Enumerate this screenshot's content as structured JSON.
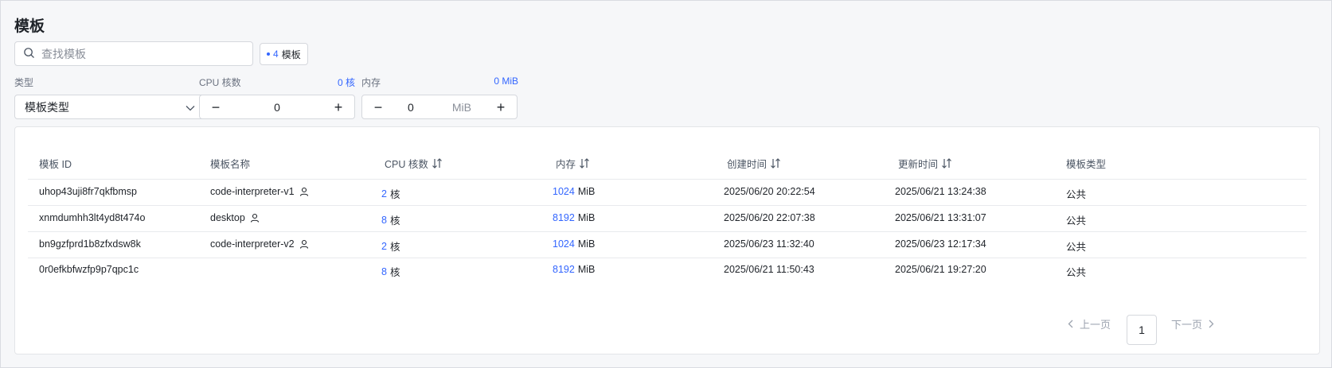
{
  "page_title": "模板",
  "search": {
    "placeholder": "查找模板"
  },
  "badge": {
    "count": "4",
    "label": "模板"
  },
  "filters": {
    "type_label": "类型",
    "type_value": "模板类型",
    "cpu_label": "CPU 核数",
    "cpu_value_display": "0 核",
    "cpu_stepper_value": "0",
    "memory_label": "内存",
    "memory_value_display": "0 MiB",
    "memory_stepper_value": "0",
    "memory_unit": "MiB"
  },
  "table": {
    "headers": {
      "id": "模板 ID",
      "name": "模板名称",
      "cpu": "CPU 核数",
      "memory": "内存",
      "created": "创建时间",
      "updated": "更新时间",
      "type": "模板类型"
    },
    "rows": [
      {
        "id": "uhop43uji8fr7qkfbmsp",
        "name": "code-interpreter-v1",
        "cpu": "2",
        "cpu_unit": "核",
        "memory": "1024",
        "memory_unit": "MiB",
        "created": "2025/06/20 20:22:54",
        "updated": "2025/06/21 13:24:38",
        "type": "公共"
      },
      {
        "id": "xnmdumhh3lt4yd8t474o",
        "name": "desktop",
        "cpu": "8",
        "cpu_unit": "核",
        "memory": "8192",
        "memory_unit": "MiB",
        "created": "2025/06/20 22:07:38",
        "updated": "2025/06/21 13:31:07",
        "type": "公共"
      },
      {
        "id": "bn9gzfprd1b8zfxdsw8k",
        "name": "code-interpreter-v2",
        "cpu": "2",
        "cpu_unit": "核",
        "memory": "1024",
        "memory_unit": "MiB",
        "created": "2025/06/23 11:32:40",
        "updated": "2025/06/23 12:17:34",
        "type": "公共"
      },
      {
        "id": "0r0efkbfwzfp9p7qpc1c",
        "name": "",
        "cpu": "8",
        "cpu_unit": "核",
        "memory": "8192",
        "memory_unit": "MiB",
        "created": "2025/06/21 11:50:43",
        "updated": "2025/06/21 19:27:20",
        "type": "公共"
      }
    ]
  },
  "pagination": {
    "prev": "上一页",
    "current": "1",
    "next": "下一页"
  },
  "colors": {
    "accent": "#3366ff",
    "border": "#d5d8dd",
    "text": "#1f2329",
    "muted": "#6b7280"
  }
}
